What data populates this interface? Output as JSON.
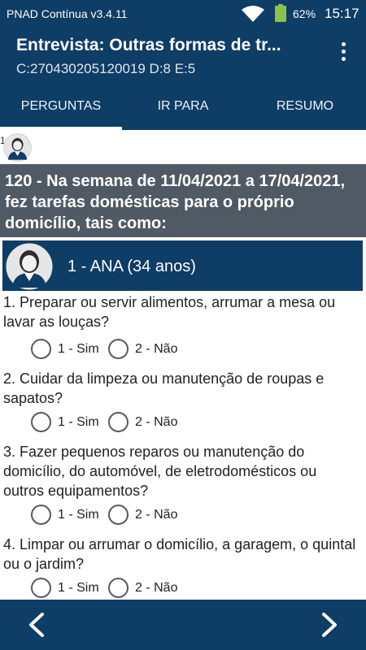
{
  "status_bar": {
    "app_label": "PNAD Contínua v3.4.11",
    "battery": "62%",
    "time": "15:17",
    "icons": [
      "wifi-icon",
      "battery-icon"
    ]
  },
  "app_bar": {
    "title": "Entrevista: Outras formas de tr...",
    "subtitle": "C:270430205120019 D:8 E:5",
    "menu_icon": "more-vert-icon"
  },
  "tabs": [
    {
      "label": "PERGUNTAS",
      "active": true
    },
    {
      "label": "IR PARA",
      "active": false
    },
    {
      "label": "RESUMO",
      "active": false
    }
  ],
  "strip": {
    "number": "1"
  },
  "question_header": "120 - Na semana de 11/04/2021 a 17/04/2021, fez tarefas domésticas para o próprio domicílio, tais como:",
  "person": {
    "label": "1 - ANA (34 anos)"
  },
  "questions": [
    {
      "text": "1. Preparar ou servir alimentos, arrumar a mesa ou lavar as louças?",
      "options": [
        "1 - Sim",
        "2 - Não"
      ]
    },
    {
      "text": "2. Cuidar da limpeza ou manutenção de roupas e sapatos?",
      "options": [
        "1 - Sim",
        "2 - Não"
      ]
    },
    {
      "text": "3. Fazer pequenos reparos ou manutenção do domicílio, do automóvel, de eletrodomésticos ou outros equipamentos?",
      "options": [
        "1 - Sim",
        "2 - Não"
      ]
    },
    {
      "text": "4. Limpar ou arrumar o domicílio, a garagem, o quintal ou o jardim?",
      "options": [
        "1 - Sim",
        "2 - Não"
      ]
    }
  ],
  "colors": {
    "primary": "#0e3d65",
    "header_gray": "#505a65",
    "battery": "#8bc34a"
  }
}
